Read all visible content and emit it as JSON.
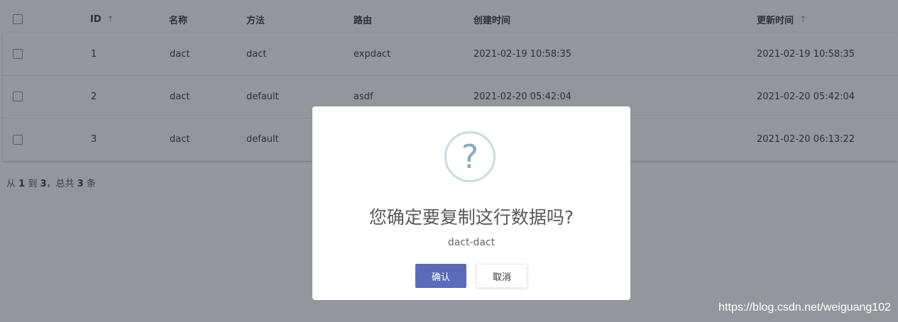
{
  "table": {
    "headers": {
      "id": "ID",
      "name": "名称",
      "method": "方法",
      "route": "路由",
      "created": "创建时间",
      "updated": "更新时间"
    },
    "sort_arrow": "↑",
    "rows": [
      {
        "id": "1",
        "name": "dact",
        "method": "dact",
        "route": "expdact",
        "created": "2021-02-19 10:58:35",
        "updated": "2021-02-19 10:58:35"
      },
      {
        "id": "2",
        "name": "dact",
        "method": "default",
        "route": "asdf",
        "created": "2021-02-20 05:42:04",
        "updated": "2021-02-20 05:42:04"
      },
      {
        "id": "3",
        "name": "dact",
        "method": "default",
        "route": "",
        "created": "",
        "updated": "2021-02-20 06:13:22"
      }
    ]
  },
  "pager": {
    "from_label": "从",
    "from": "1",
    "to_label": "到",
    "to": "3",
    "total_label": "，总共",
    "total": "3",
    "unit": "条"
  },
  "modal": {
    "icon": "question-icon",
    "icon_glyph": "?",
    "title": "您确定要复制这行数据吗?",
    "text": "dact-dact",
    "confirm_label": "确认",
    "cancel_label": "取消",
    "confirm_color": "#5a6bbc"
  },
  "watermark": "https://blog.csdn.net/weiguang102"
}
